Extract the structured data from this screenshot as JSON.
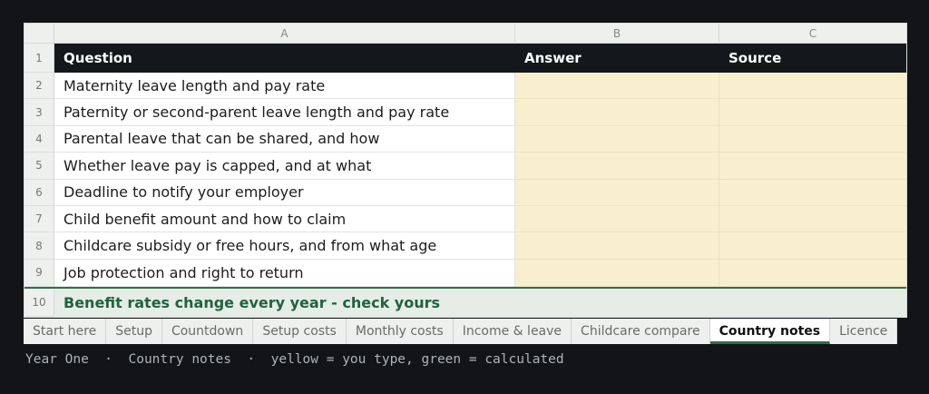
{
  "columns": {
    "corner": "",
    "a": "A",
    "b": "B",
    "c": "C"
  },
  "header_row": {
    "num": "1",
    "question": "Question",
    "answer": "Answer",
    "source": "Source"
  },
  "rows": [
    {
      "num": "2",
      "question": "Maternity leave length and pay rate"
    },
    {
      "num": "3",
      "question": "Paternity or second-parent leave length and pay rate"
    },
    {
      "num": "4",
      "question": "Parental leave that can be shared, and how"
    },
    {
      "num": "5",
      "question": "Whether leave pay is capped, and at what"
    },
    {
      "num": "6",
      "question": "Deadline to notify your employer"
    },
    {
      "num": "7",
      "question": "Child benefit amount and how to claim"
    },
    {
      "num": "8",
      "question": "Childcare subsidy or free hours, and from what age"
    },
    {
      "num": "9",
      "question": "Job protection and right to return"
    }
  ],
  "note_row": {
    "num": "10",
    "text": "Benefit rates change every year - check yours"
  },
  "tabs": [
    {
      "label": "Start here"
    },
    {
      "label": "Setup"
    },
    {
      "label": "Countdown"
    },
    {
      "label": "Setup costs"
    },
    {
      "label": "Monthly costs"
    },
    {
      "label": "Income & leave"
    },
    {
      "label": "Childcare compare"
    },
    {
      "label": "Country notes",
      "active": true
    },
    {
      "label": "Licence"
    }
  ],
  "status": "Year One  ·  Country notes  ·  yellow = you type, green = calculated",
  "colors": {
    "header_bg": "#14181c",
    "input_cell": "#f8efcf",
    "note_bg": "#e5ede6",
    "note_text": "#22613f",
    "accent": "#2f6e4b"
  }
}
